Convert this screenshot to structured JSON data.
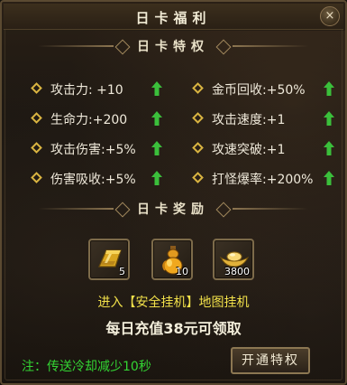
{
  "window": {
    "title": "日卡福利",
    "close_label": "×"
  },
  "privileges": {
    "header": "日卡特权",
    "left": [
      {
        "text": "攻击力: +10"
      },
      {
        "text": "生命力:+200"
      },
      {
        "text": "攻击伤害:+5%"
      },
      {
        "text": "伤害吸收:+5%"
      }
    ],
    "right": [
      {
        "text": "金币回收:+50%"
      },
      {
        "text": "攻击速度:+1"
      },
      {
        "text": "攻速突破:+1"
      },
      {
        "text": "打怪爆率:+200%"
      }
    ]
  },
  "rewards": {
    "header": "日卡奖励",
    "items": [
      {
        "icon": "gold-bar-icon",
        "count": "5"
      },
      {
        "icon": "potion-gourd-icon",
        "count": "10"
      },
      {
        "icon": "gold-ingot-icon",
        "count": "3800"
      }
    ]
  },
  "message_line1": "进入【安全挂机】地图挂机",
  "message_line2": "每日充值38元可领取",
  "note": "注：传送冷却减少10秒",
  "open_button": "开通特权",
  "colors": {
    "diamond": "#d9b441",
    "arrow": "#3bbf3b",
    "highlight_text": "#f2e14a",
    "note_text": "#33d433"
  }
}
